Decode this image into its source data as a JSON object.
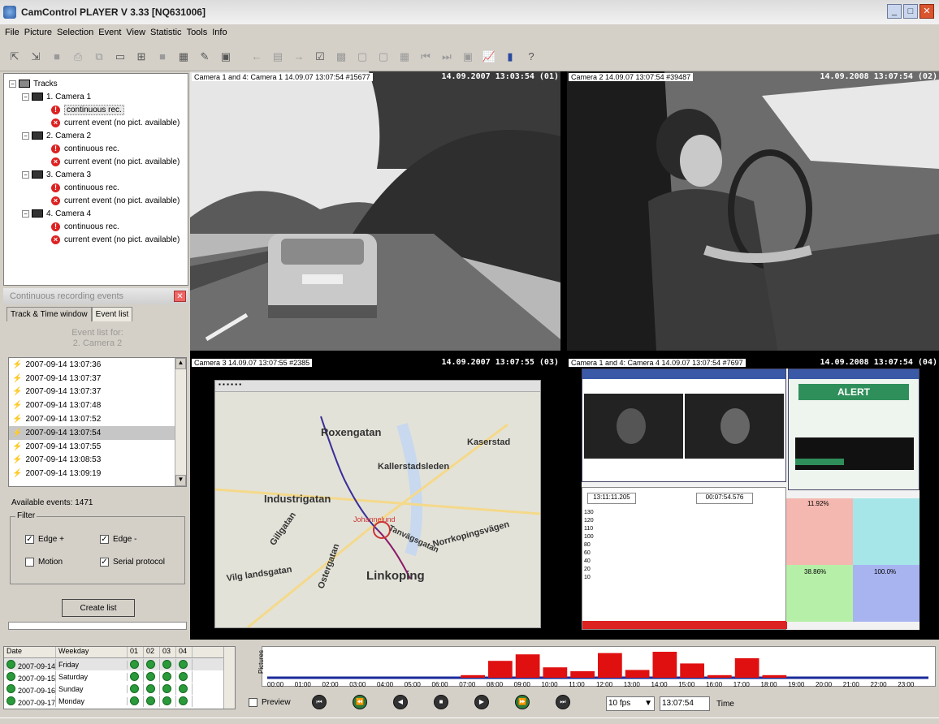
{
  "window": {
    "title": "CamControl PLAYER V 3.33 [NQ631006]"
  },
  "menu": [
    "File",
    "Picture",
    "Selection",
    "Event",
    "View",
    "Statistic",
    "Tools",
    "Info"
  ],
  "tracks": {
    "root": "Tracks",
    "cameras": [
      {
        "name": "1. Camera 1",
        "items": [
          "continuous rec.",
          "current event (no pict. available)"
        ]
      },
      {
        "name": "2. Camera 2",
        "items": [
          "continuous rec.",
          "current event (no pict. available)"
        ]
      },
      {
        "name": "3. Camera 3",
        "items": [
          "continuous rec.",
          "current event (no pict. available)"
        ]
      },
      {
        "name": "4. Camera 4",
        "items": [
          "continuous rec.",
          "current event (no pict. available)"
        ]
      }
    ]
  },
  "events_panel": {
    "title": "Continuous recording events",
    "tabs": [
      "Track & Time window",
      "Event list"
    ],
    "event_for_line1": "Event list for:",
    "event_for_line2": "2. Camera 2",
    "events": [
      "2007-09-14 13:07:36",
      "2007-09-14 13:07:37",
      "2007-09-14 13:07:37",
      "2007-09-14 13:07:48",
      "2007-09-14 13:07:52",
      "2007-09-14 13:07:54",
      "2007-09-14 13:07:55",
      "2007-09-14 13:08:53",
      "2007-09-14 13:09:19"
    ],
    "selected_event_index": 5,
    "available_label": "Available events:",
    "available_count": "1471",
    "filter_label": "Filter",
    "filters": [
      {
        "label": "Edge +",
        "checked": true
      },
      {
        "label": "Edge -",
        "checked": true
      },
      {
        "label": "Motion",
        "checked": false
      },
      {
        "label": "Serial protocol",
        "checked": true
      }
    ],
    "create_button": "Create list"
  },
  "videos": [
    {
      "label": "Camera 1 and 4: Camera 1 14.09.07 13:07:54 #15677",
      "timestamp": "14.09.2007 13:03:54 (01)"
    },
    {
      "label": "Camera 2 14.09.07 13:07:54 #39487",
      "timestamp": "14.09.2008 13:07:54 (02)"
    },
    {
      "label": "Camera 3 14.09.07 13:07:55 #2385",
      "timestamp": "14.09.2007 13:07:55 (03)"
    },
    {
      "label": "Camera 1 and 4: Camera 4 14.09.07 13:07:54 #7697",
      "timestamp": "14.09.2008 13:07:54 (04)"
    }
  ],
  "map_labels": [
    "Roxengatan",
    "Kaserstad",
    "Kallerstadsleden",
    "Industrigatan",
    "Johannelund",
    "Gillgatan",
    "Ostergatan",
    "Linkoping",
    "Vilg landsgatan",
    "Norrkopingsvägen",
    "Tanvägsgatan"
  ],
  "dashboard": {
    "alert": "ALERT",
    "time_left": "13:11:11.205",
    "time_right": "00:07:54.576",
    "pct1": "11.92%",
    "pct2": "38.86%",
    "pct3": "100.0%",
    "yticks": [
      "130",
      "120",
      "110",
      "100",
      "80",
      "60",
      "40",
      "20",
      "10"
    ]
  },
  "days": {
    "headers": [
      "Date",
      "Weekday",
      "01",
      "02",
      "03",
      "04"
    ],
    "rows": [
      {
        "date": "2007-09-14",
        "weekday": "Friday"
      },
      {
        "date": "2007-09-15",
        "weekday": "Saturday"
      },
      {
        "date": "2007-09-16",
        "weekday": "Sunday"
      },
      {
        "date": "2007-09-17",
        "weekday": "Monday"
      }
    ]
  },
  "timeline": {
    "ylabel": "Pictures",
    "hours": [
      "00:00",
      "01:00",
      "02:00",
      "03:00",
      "04:00",
      "05:00",
      "06:00",
      "07:00",
      "08:00",
      "09:00",
      "10:00",
      "11:00",
      "12:00",
      "13:00",
      "14:00",
      "15:00",
      "16:00",
      "17:00",
      "18:00",
      "19:00",
      "20:00",
      "21:00",
      "22:00",
      "23:00"
    ],
    "bars": [
      0,
      0,
      0,
      0,
      0,
      0,
      0,
      0.1,
      0.65,
      0.9,
      0.4,
      0.25,
      0.95,
      0.3,
      1.0,
      0.55,
      0.1,
      0.75,
      0.1,
      0,
      0,
      0,
      0,
      0
    ]
  },
  "controls": {
    "preview": "Preview",
    "fps": "10 fps",
    "time": "13:07:54",
    "time_label": "Time"
  },
  "colors": {
    "bar": "#e01010",
    "active_dot": "#2a9a3a"
  }
}
